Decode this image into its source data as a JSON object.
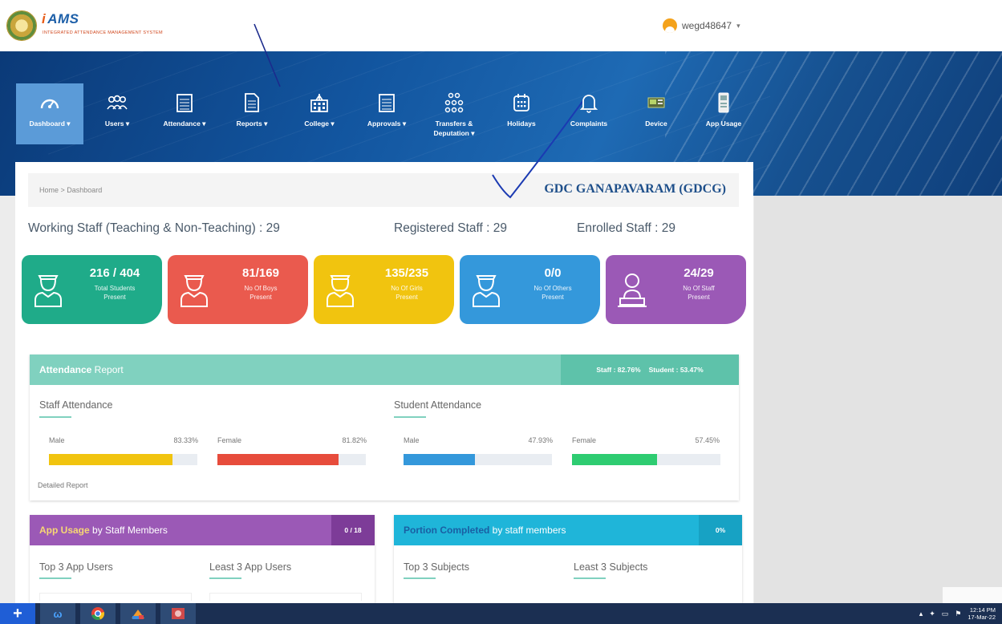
{
  "header": {
    "logo_i": "i",
    "logo_title": "AMS",
    "logo_subtitle": "INTEGRATED ATTENDANCE MANAGEMENT SYSTEM",
    "username": "wegd48647",
    "caret": "▾"
  },
  "nav": {
    "items": [
      {
        "label": "Dashboard ▾",
        "icon": "speedometer-icon"
      },
      {
        "label": "Users ▾",
        "icon": "users-icon"
      },
      {
        "label": "Attendance ▾",
        "icon": "calendar-icon"
      },
      {
        "label": "Reports ▾",
        "icon": "document-icon"
      },
      {
        "label": "College ▾",
        "icon": "building-icon"
      },
      {
        "label": "Approvals ▾",
        "icon": "calendar-icon"
      },
      {
        "label": "Transfers & Deputation ▾",
        "icon": "org-chart-icon"
      },
      {
        "label": "Holidays",
        "icon": "calendar-grid-icon"
      },
      {
        "label": "Complaints",
        "icon": "bell-icon"
      },
      {
        "label": "Device",
        "icon": "device-icon"
      },
      {
        "label": "App Usage",
        "icon": "phone-icon"
      }
    ]
  },
  "breadcrumb": {
    "text": "Home > Dashboard"
  },
  "college_name": "GDC GANAPAVARAM (GDCG)",
  "stats": {
    "working": "Working Staff (Teaching & Non-Teaching) : 29",
    "registered": "Registered Staff : 29",
    "enrolled": "Enrolled Staff : 29"
  },
  "tiles": [
    {
      "value": "216 / 404",
      "label1": "Total Students",
      "label2": "Present",
      "color": "#1fab89"
    },
    {
      "value": "81/169",
      "label1": "No Of Boys",
      "label2": "Present",
      "color": "#ea5a4e"
    },
    {
      "value": "135/235",
      "label1": "No Of Girls",
      "label2": "Present",
      "color": "#f1c40f"
    },
    {
      "value": "0/0",
      "label1": "No Of Others",
      "label2": "Present",
      "color": "#3498db"
    },
    {
      "value": "24/29",
      "label1": "No Of Staff",
      "label2": "Present",
      "color": "#9b59b6"
    }
  ],
  "attendance": {
    "title_bold": "Attendance",
    "title_rest": " Report",
    "staff_pct": "Staff : 82.76%",
    "student_pct": "Student : 53.47%",
    "staff_title": "Staff Attendance",
    "student_title": "Student Attendance",
    "bars": [
      {
        "label": "Male",
        "pct": "83.33%",
        "value": 83.33,
        "color": "#f1c40f"
      },
      {
        "label": "Female",
        "pct": "81.82%",
        "value": 81.82,
        "color": "#e74c3c"
      },
      {
        "label": "Male",
        "pct": "47.93%",
        "value": 47.93,
        "color": "#3498db"
      },
      {
        "label": "Female",
        "pct": "57.45%",
        "value": 57.45,
        "color": "#2ecc71"
      }
    ],
    "detailed": "Detailed Report"
  },
  "app_usage": {
    "title_bold": "App Usage",
    "title_rest": " by Staff Members",
    "badge": "0 / 18",
    "top": "Top 3 App Users",
    "least": "Least 3 App Users"
  },
  "portion": {
    "title_bold": "Portion Completed",
    "title_rest": " by staff members",
    "badge": "0%",
    "top": "Top 3 Subjects",
    "least": "Least 3 Subjects"
  },
  "taskbar": {
    "start": "+",
    "time": "12:14 PM",
    "date": "17-Mar-22"
  },
  "colors": {
    "banner": "#12559f",
    "attendance_head": "#80d1bf",
    "app_usage_head": "#9b59b6",
    "portion_head": "#1fb5d9"
  }
}
